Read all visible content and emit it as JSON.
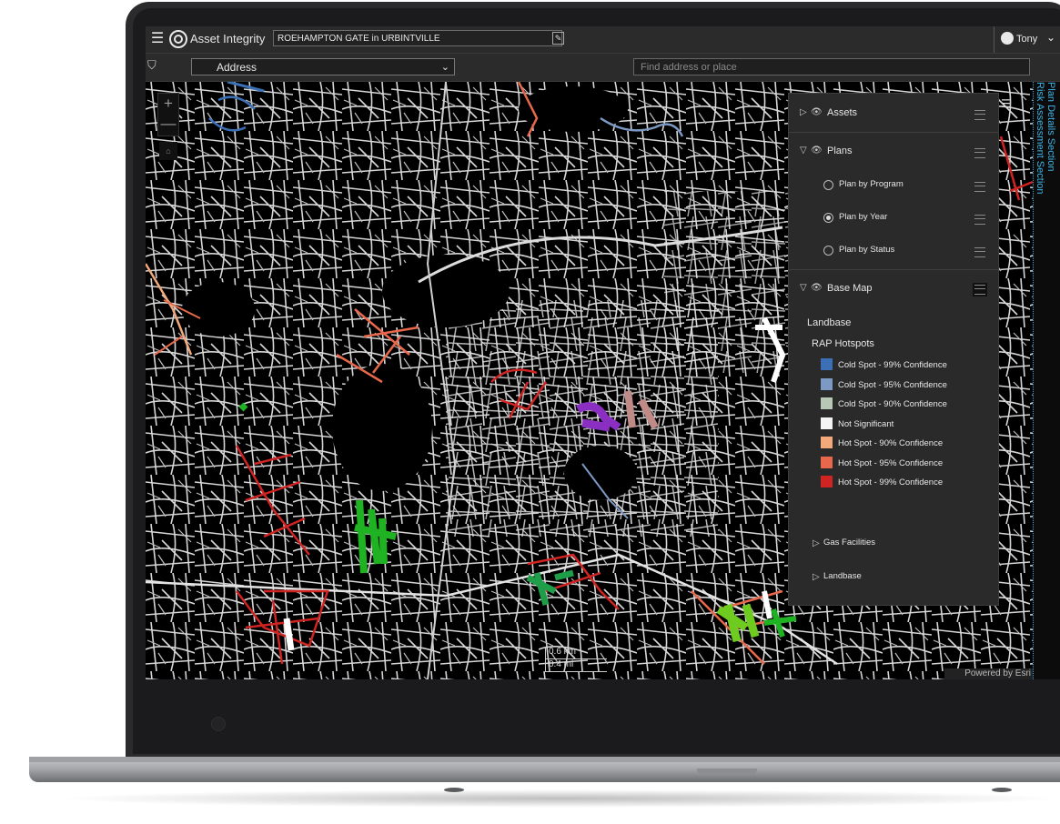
{
  "app": {
    "title": "Asset Integrity",
    "location": "ROEHAMPTON GATE in URBINTVILLE",
    "user": "Tony"
  },
  "toolbar": {
    "search_type": "Address",
    "search_placeholder": "Find address or place"
  },
  "side_tabs": [
    "Plan Details Section",
    "Risk Assessment Section"
  ],
  "map": {
    "scale_top": "0.6 km",
    "scale_bottom": "0.4 mi",
    "attribution": "Powered by Esri",
    "zoom_in": "+",
    "zoom_out": "—"
  },
  "layers": {
    "assets": "Assets",
    "plans": "Plans",
    "plan_options": [
      {
        "label": "Plan by Program",
        "selected": false
      },
      {
        "label": "Plan by Year",
        "selected": true
      },
      {
        "label": "Plan by Status",
        "selected": false
      }
    ],
    "base_map": "Base Map",
    "landbase": "Landbase",
    "rap_hotspots": "RAP Hotspots",
    "legend": [
      {
        "label": "Cold Spot - 99% Confidence",
        "color": "#3b6fb6"
      },
      {
        "label": "Cold Spot - 95% Confidence",
        "color": "#7d9ac4"
      },
      {
        "label": "Cold Spot - 90% Confidence",
        "color": "#b8c8b6"
      },
      {
        "label": "Not Significant",
        "color": "#f4f4f4"
      },
      {
        "label": "Hot Spot - 90% Confidence",
        "color": "#f4a97a"
      },
      {
        "label": "Hot Spot - 95% Confidence",
        "color": "#e8684b"
      },
      {
        "label": "Hot Spot - 99% Confidence",
        "color": "#cf2422"
      }
    ],
    "gas_facilities": "Gas Facilities",
    "landbase_group": "Landbase"
  }
}
